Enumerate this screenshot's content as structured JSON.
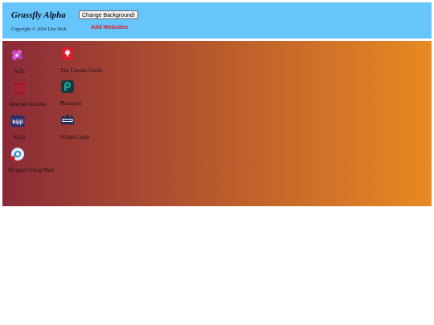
{
  "header": {
    "title": "Grassfly Alpha",
    "copyright": "Copyright © 2024 Uno Tech",
    "change_background_label": "Change Background!",
    "add_websites_label": "Add Websites",
    "background_color": "#66c6fb"
  },
  "main": {
    "gradient_start": "#8a2a38",
    "gradient_end": "#e88a22"
  },
  "tiles": [
    {
      "label": "AOL",
      "icon": "aol-flower-icon"
    },
    {
      "label": "The Canada Guide",
      "icon": "canada-guide-icon"
    },
    {
      "label": "Internet Archive",
      "icon": "internet-archive-icon"
    },
    {
      "label": "Photopea",
      "icon": "photopea-icon"
    },
    {
      "label": "Kijiji",
      "icon": "kijiji-icon"
    },
    {
      "label": "White Castle",
      "icon": "white-castle-icon"
    },
    {
      "label": "Shoppers Drug Mart",
      "icon": "shoppers-drug-mart-icon"
    }
  ]
}
